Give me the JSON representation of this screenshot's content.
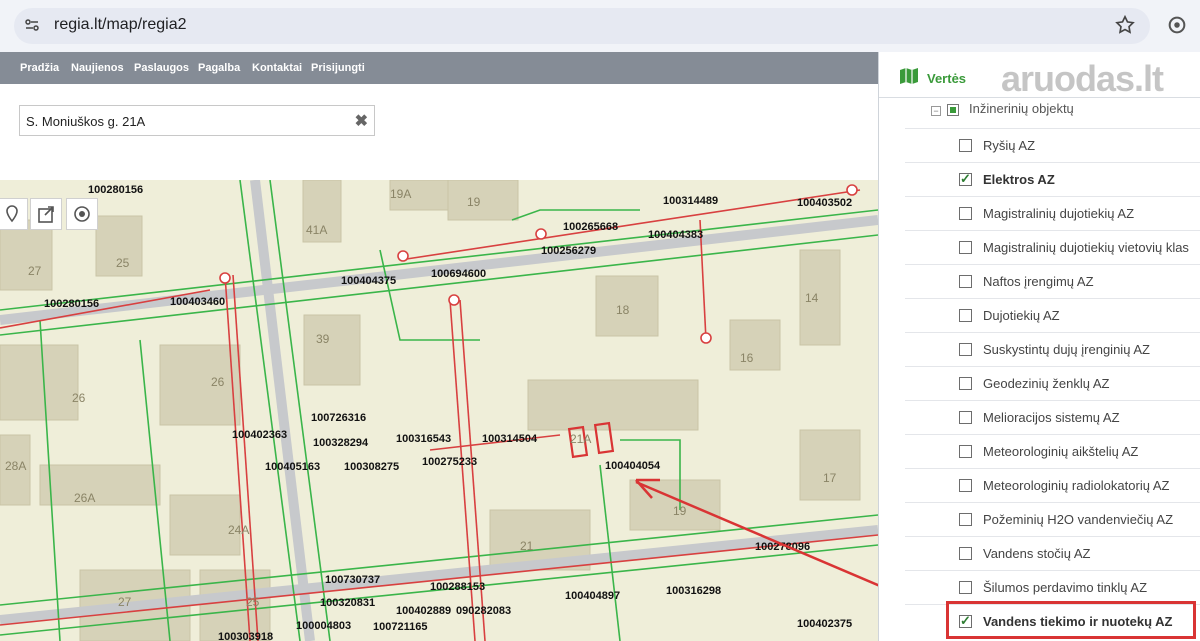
{
  "browser": {
    "url": "regia.lt/map/regia2"
  },
  "nav": {
    "items": [
      "Pradžia",
      "Naujienos",
      "Paslaugos",
      "Pagalba",
      "Kontaktai",
      "Prisijungti"
    ]
  },
  "search": {
    "value": "S. Moniuškos g. 21A",
    "clear_symbol": "✖"
  },
  "map": {
    "building_numbers": [
      "19A",
      "19",
      "41A",
      "27",
      "25",
      "39",
      "18",
      "14",
      "16",
      "26",
      "26",
      "28A",
      "26A",
      "24A",
      "21",
      "17",
      "19",
      "25",
      "27",
      "21A"
    ],
    "cadastral_labels": [
      "100280156",
      "100314489",
      "100403502",
      "100265668",
      "100404383",
      "100256279",
      "100404375",
      "100694600",
      "100280156",
      "100403460",
      "100726316",
      "100402363",
      "100328294",
      "100316543",
      "100314504",
      "100405163",
      "100308275",
      "100275233",
      "100404054",
      "100278096",
      "100730737",
      "100288153",
      "100316298",
      "100320831",
      "100402889",
      "090282083",
      "100404897",
      "100004803",
      "100721165",
      "100303918",
      "100402375"
    ],
    "colors": {
      "base": "#efeed9",
      "building": "#d6d2b8",
      "road": "#c7c9cc",
      "green_line": "#3ab54a",
      "red_line": "#d84040",
      "highlight_arrow": "#d93434"
    }
  },
  "panel": {
    "title": "Vertės",
    "watermark": "aruodas.lt",
    "group_label": "Inžinerinių objektų",
    "layers": [
      {
        "label": "Ryšių AZ",
        "checked": false,
        "bold": false
      },
      {
        "label": "Elektros AZ",
        "checked": true,
        "bold": true
      },
      {
        "label": "Magistralinių dujotiekių AZ",
        "checked": false,
        "bold": false
      },
      {
        "label": "Magistralinių dujotiekių vietovių klas",
        "checked": false,
        "bold": false
      },
      {
        "label": "Naftos įrengimų AZ",
        "checked": false,
        "bold": false
      },
      {
        "label": "Dujotiekių AZ",
        "checked": false,
        "bold": false
      },
      {
        "label": "Suskystintų dujų įrenginių AZ",
        "checked": false,
        "bold": false
      },
      {
        "label": "Geodezinių ženklų AZ",
        "checked": false,
        "bold": false
      },
      {
        "label": "Melioracijos sistemų AZ",
        "checked": false,
        "bold": false
      },
      {
        "label": "Meteorologinių aikštelių AZ",
        "checked": false,
        "bold": false
      },
      {
        "label": "Meteorologinių radiolokatorių AZ",
        "checked": false,
        "bold": false
      },
      {
        "label": "Požeminių H2O vandenviečių AZ",
        "checked": false,
        "bold": false
      },
      {
        "label": "Vandens stočių AZ",
        "checked": false,
        "bold": false
      },
      {
        "label": "Šilumos perdavimo tinklų AZ",
        "checked": false,
        "bold": false
      },
      {
        "label": "Vandens tiekimo ir nuotekų AZ",
        "checked": true,
        "bold": true
      }
    ]
  }
}
